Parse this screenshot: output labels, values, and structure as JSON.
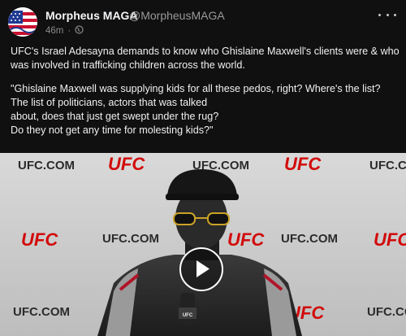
{
  "post": {
    "author_name": "Morpheus MAGA",
    "author_handle": "@MorpheusMAGA",
    "timestamp": "46m",
    "separator": "·",
    "visibility_icon": "globe-icon",
    "more_icon": "more-options-icon",
    "text_lines": [
      "UFC's Israel Adesayna demands to know who Ghislaine Maxwell's clients were & who",
      "was involved in trafficking children across the world.",
      "\"Ghislaine Maxwell was supplying kids for all these pedos, right? Where's the list?",
      "The list of politicians, actors that was talked",
      "about, does that just get swept under the rug?",
      "Do they not get any time for molesting kids?\""
    ]
  },
  "video": {
    "backdrop_logos": [
      "UFC.COM",
      "UFC"
    ],
    "play_icon": "play-icon",
    "mic_label": "UFC"
  },
  "colors": {
    "background": "#101010",
    "text": "#f3f5f7",
    "muted": "#8a8a8a",
    "ufc_red": "#d20a0a"
  }
}
